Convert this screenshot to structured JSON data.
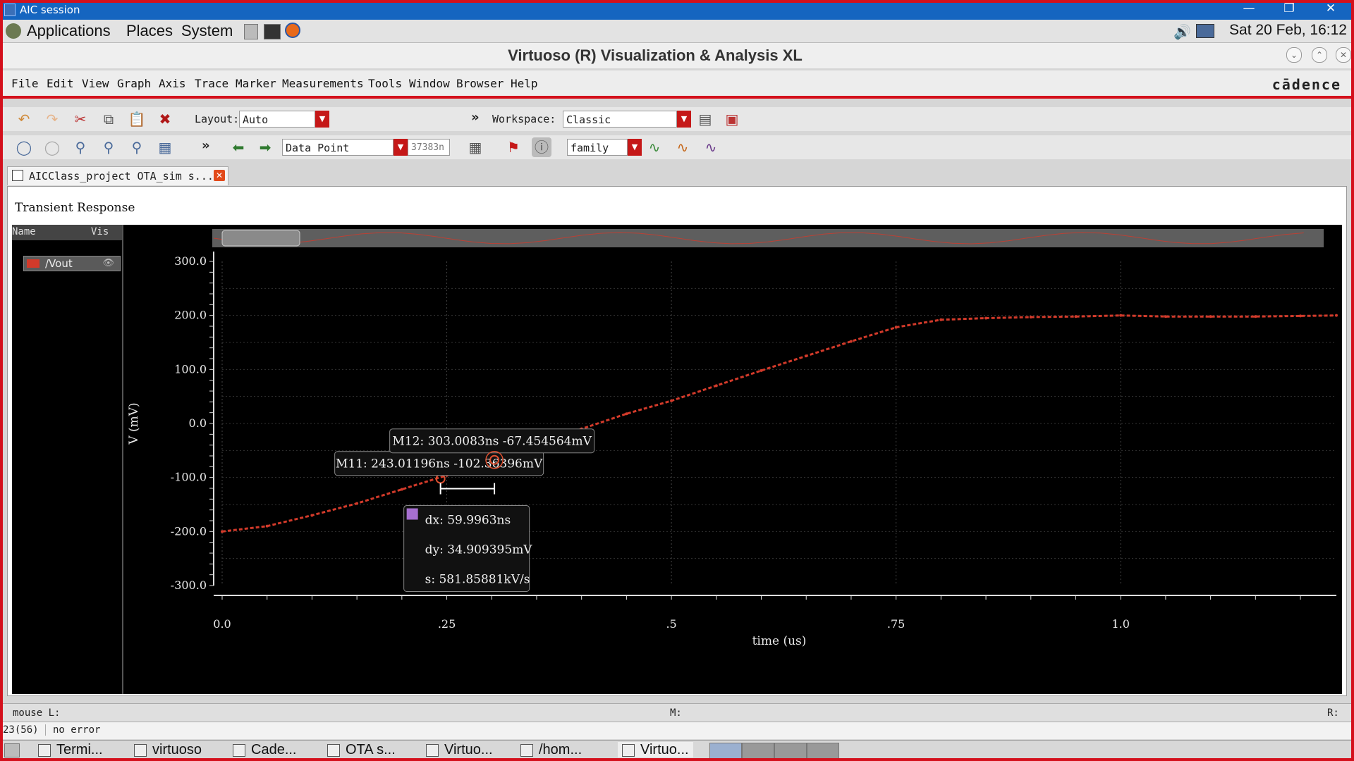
{
  "session_title": "AIC session",
  "gnome": {
    "menus": [
      "Applications",
      "Places",
      "System"
    ],
    "clock": "Sat 20 Feb, 16:12"
  },
  "window_title": "Virtuoso (R) Visualization & Analysis XL",
  "menubar": [
    "File",
    "Edit",
    "View",
    "Graph",
    "Axis",
    "Trace",
    "Marker",
    "Measurements",
    "Tools",
    "Window",
    "Browser",
    "Help"
  ],
  "brand": "cādence",
  "toolbar1": {
    "layout_label": "Layout:",
    "layout_value": "Auto",
    "workspace_label": "Workspace:",
    "workspace_value": "Classic"
  },
  "toolbar2": {
    "marker_mode": "Data Point",
    "marker_value": "37383n",
    "family_value": "family"
  },
  "tab_label": "AICClass_project OTA_sim s...",
  "graph_title": "Transient Response",
  "legend": {
    "col_name": "Name",
    "col_vis": "Vis",
    "trace_name": "/Vout",
    "trace_color": "#d23a2a"
  },
  "chart_data": {
    "type": "line",
    "xlabel": "time (us)",
    "ylabel": "V (mV)",
    "xlim": [
      0,
      1.24
    ],
    "ylim": [
      -300,
      300
    ],
    "x_ticks": [
      "0.0",
      ".25",
      ".5",
      ".75",
      "1.0"
    ],
    "x_tick_values": [
      0,
      0.25,
      0.5,
      0.75,
      1.0
    ],
    "y_ticks": [
      "300.0",
      "200.0",
      "100.0",
      "0.0",
      "-100.0",
      "-200.0",
      "-300.0"
    ],
    "y_tick_values": [
      300,
      200,
      100,
      0,
      -100,
      -200,
      -300
    ],
    "series": [
      {
        "name": "/Vout",
        "color": "#d23a2a",
        "x": [
          0,
          0.05,
          0.1,
          0.15,
          0.2,
          0.25,
          0.3,
          0.35,
          0.4,
          0.45,
          0.5,
          0.55,
          0.6,
          0.65,
          0.7,
          0.75,
          0.8,
          0.85,
          0.9,
          0.95,
          1.0,
          1.05,
          1.1,
          1.15,
          1.2,
          1.24
        ],
        "y": [
          -200,
          -190,
          -170,
          -148,
          -122,
          -96,
          -67,
          -38,
          -10,
          18,
          42,
          70,
          98,
          125,
          152,
          178,
          192,
          195,
          197,
          198,
          200,
          198,
          198,
          198,
          199,
          200
        ]
      }
    ],
    "markers": [
      {
        "label": "M11: 243.01196ns -102.36396mV",
        "x": 0.243012,
        "y": -102.36396
      },
      {
        "label": "M12: 303.0083ns -67.454564mV",
        "x": 0.303008,
        "y": -67.454564
      }
    ],
    "delta": {
      "dx": "dx: 59.9963ns",
      "dy": "dy: 34.909395mV",
      "s": "s: 581.85881kV/s"
    },
    "grid": true
  },
  "status": {
    "mouse_l": "mouse L:",
    "m": "M:",
    "r": "R:",
    "line_no": "23(56)",
    "message": "no error"
  },
  "taskbar": [
    "Termi...",
    "virtuoso",
    "Cade...",
    "OTA s...",
    "Virtuo...",
    "/hom...",
    "Virtuo..."
  ]
}
